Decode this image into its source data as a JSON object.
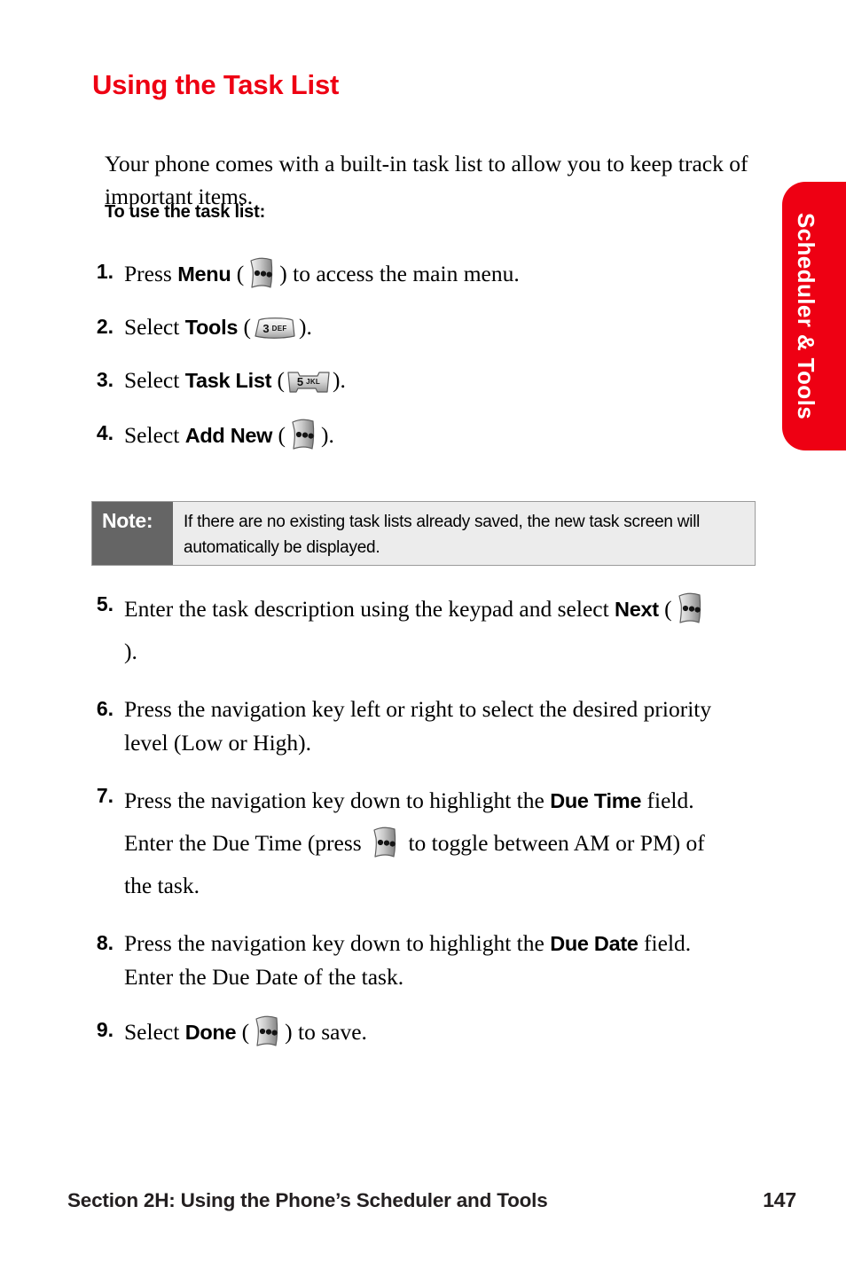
{
  "side_tab": {
    "label": "Scheduler & Tools",
    "color": "#ee0013"
  },
  "heading": {
    "title": "Using the Task List",
    "color": "#ee0013"
  },
  "intro": {
    "paragraph": "Your phone comes with a built-in task list to allow you to keep track of important items."
  },
  "subhead": {
    "text": "To use the task list:"
  },
  "steps_before_note": [
    {
      "number": "1.",
      "pre": "Press ",
      "bold": "Menu",
      "mid": " (",
      "icon": "softkey-menu-icon",
      "post": ") to access the main menu."
    },
    {
      "number": "2.",
      "pre": "Select ",
      "bold": "Tools",
      "mid": " (",
      "icon": "keypad-3-def-icon",
      "key_digit": "3",
      "key_letters": "DEF",
      "post": ")."
    },
    {
      "number": "3.",
      "pre": "Select ",
      "bold": "Task List",
      "mid": " (",
      "icon": "keypad-5-jkl-icon",
      "key_digit": "5",
      "key_letters": "JKL",
      "post": ")."
    },
    {
      "number": "4.",
      "pre": "Select ",
      "bold": "Add New",
      "mid": " (",
      "icon": "softkey-menu-icon",
      "post": ")."
    }
  ],
  "note": {
    "label": "Note:",
    "text": "If there are no existing task lists already saved, the new task screen will automatically be displayed.",
    "label_bg": "#656565",
    "body_bg": "#ececec"
  },
  "steps_after_note": [
    {
      "number": "5.",
      "pre": "Enter the task description using the keypad and select ",
      "bold": "Next",
      "mid": " (",
      "icon": "softkey-menu-icon",
      "post": ")."
    },
    {
      "number": "6.",
      "pre": "Press the navigation key left or right to select the desired priority level (Low or High).",
      "bold": "",
      "mid": "",
      "icon": "",
      "post": ""
    },
    {
      "number": "7.",
      "pre": "Press the navigation key down to highlight the ",
      "bold": "Due Time",
      "mid": " field. Enter the Due Time (press ",
      "icon": "softkey-menu-icon",
      "post": " to toggle between AM or PM) of the task."
    },
    {
      "number": "8.",
      "pre": "Press the navigation key down to highlight the ",
      "bold": "Due Date",
      "mid": " field. Enter the Due Date of the task.",
      "icon": "",
      "post": ""
    },
    {
      "number": "9.",
      "pre": "Select ",
      "bold": "Done",
      "mid": " (",
      "icon": "softkey-menu-icon",
      "post": ") to save."
    }
  ],
  "footer": {
    "section": "Section 2H: Using the Phone’s Scheduler and Tools",
    "page": "147"
  }
}
